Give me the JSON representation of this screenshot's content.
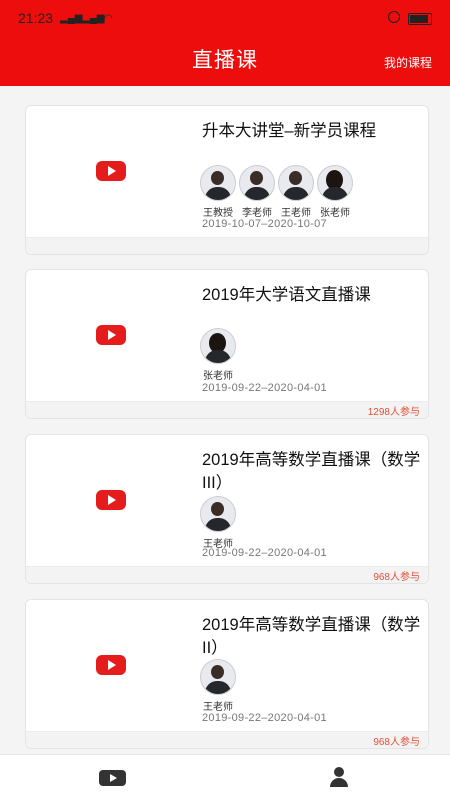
{
  "status": {
    "time": "21:23"
  },
  "header": {
    "title": "直播课",
    "my_courses": "我的课程"
  },
  "courses": [
    {
      "title": "升本大讲堂–新学员课程",
      "teachers": [
        "王教授",
        "李老师",
        "王老师",
        "张老师"
      ],
      "date": "2019-10-07–2020-10-07",
      "count": ""
    },
    {
      "title": "2019年大学语文直播课",
      "teachers": [
        "张老师"
      ],
      "date": "2019-09-22–2020-04-01",
      "count": "1298人参与"
    },
    {
      "title": "2019年高等数学直播课（数学III）",
      "teachers": [
        "王老师"
      ],
      "date": "2019-09-22–2020-04-01",
      "count": "968人参与"
    },
    {
      "title": "2019年高等数学直播课（数学II）",
      "teachers": [
        "王老师"
      ],
      "date": "2019-09-22–2020-04-01",
      "count": "968人参与"
    }
  ],
  "tabs": [
    {
      "icon": "play-icon"
    },
    {
      "icon": "user-icon"
    }
  ]
}
